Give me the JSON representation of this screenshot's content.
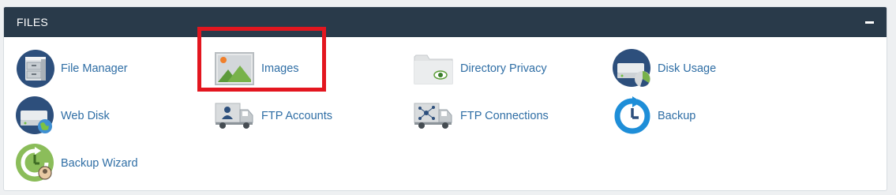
{
  "section": {
    "title": "FILES",
    "collapse_icon": "minus-icon"
  },
  "items": [
    {
      "label": "File Manager",
      "icon": "file-manager-icon"
    },
    {
      "label": "Images",
      "icon": "images-icon"
    },
    {
      "label": "Directory Privacy",
      "icon": "directory-privacy-icon"
    },
    {
      "label": "Disk Usage",
      "icon": "disk-usage-icon"
    },
    {
      "label": "Web Disk",
      "icon": "web-disk-icon"
    },
    {
      "label": "FTP Accounts",
      "icon": "ftp-accounts-icon"
    },
    {
      "label": "FTP Connections",
      "icon": "ftp-connections-icon"
    },
    {
      "label": "Backup",
      "icon": "backup-icon"
    },
    {
      "label": "Backup Wizard",
      "icon": "backup-wizard-icon"
    }
  ],
  "colors": {
    "header_bg": "#293a4a",
    "link": "#2f6ea5",
    "highlight": "#e3161f"
  },
  "highlighted_item": "Images"
}
